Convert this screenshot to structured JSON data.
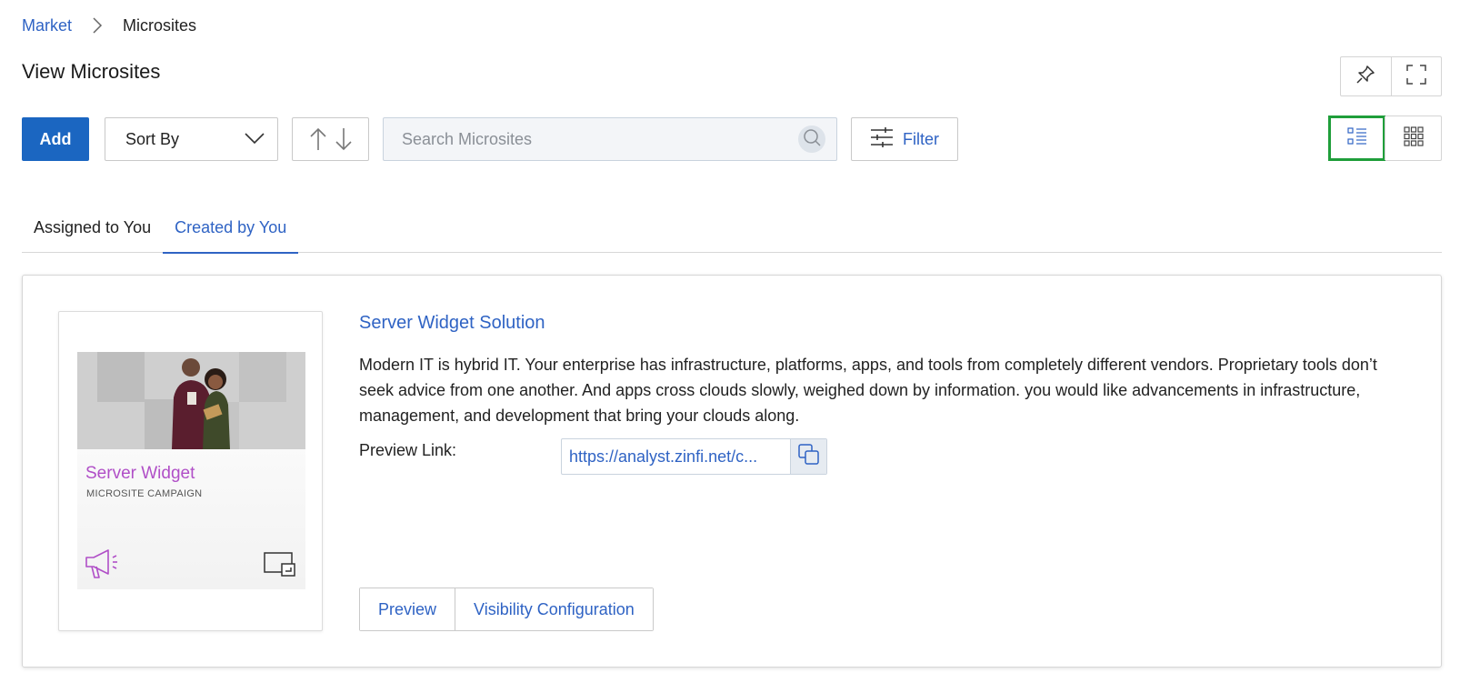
{
  "breadcrumb": {
    "root": "Market",
    "current": "Microsites"
  },
  "page": {
    "title": "View Microsites"
  },
  "toolbar": {
    "add_label": "Add",
    "sort_label": "Sort By",
    "search_placeholder": "Search Microsites",
    "filter_label": "Filter"
  },
  "icons": {
    "pin": "pin-icon",
    "fullscreen": "fullscreen-icon",
    "list_view": "list-view-icon",
    "grid_view": "grid-view-icon",
    "search": "search-icon",
    "filter": "sliders-icon",
    "sort": "sort-arrows-icon",
    "copy": "copy-icon"
  },
  "view_mode": {
    "selected": "list"
  },
  "tabs": [
    {
      "label": "Assigned to You",
      "active": false
    },
    {
      "label": "Created by You",
      "active": true
    }
  ],
  "microsite": {
    "title": "Server Widget Solution",
    "description": "Modern IT is hybrid IT. Your enterprise has infrastructure, platforms, apps, and tools from completely different vendors. Proprietary tools don’t seek advice from one another. And apps cross clouds slowly, weighed down by information. you would like advancements in infrastructure, management, and development that bring your clouds along.",
    "preview_link_label": "Preview Link:",
    "preview_link": "https://analyst.zinfi.net/c...",
    "thumbnail": {
      "title": "Server Widget",
      "subtitle": "MICROSITE CAMPAIGN"
    },
    "actions": {
      "preview": "Preview",
      "visibility": "Visibility Configuration"
    }
  },
  "colors": {
    "accent": "#2f63c4",
    "primary_button": "#1b66c1",
    "thumb_title": "#b04fc7",
    "active_view_outline": "#1f9e3a"
  }
}
